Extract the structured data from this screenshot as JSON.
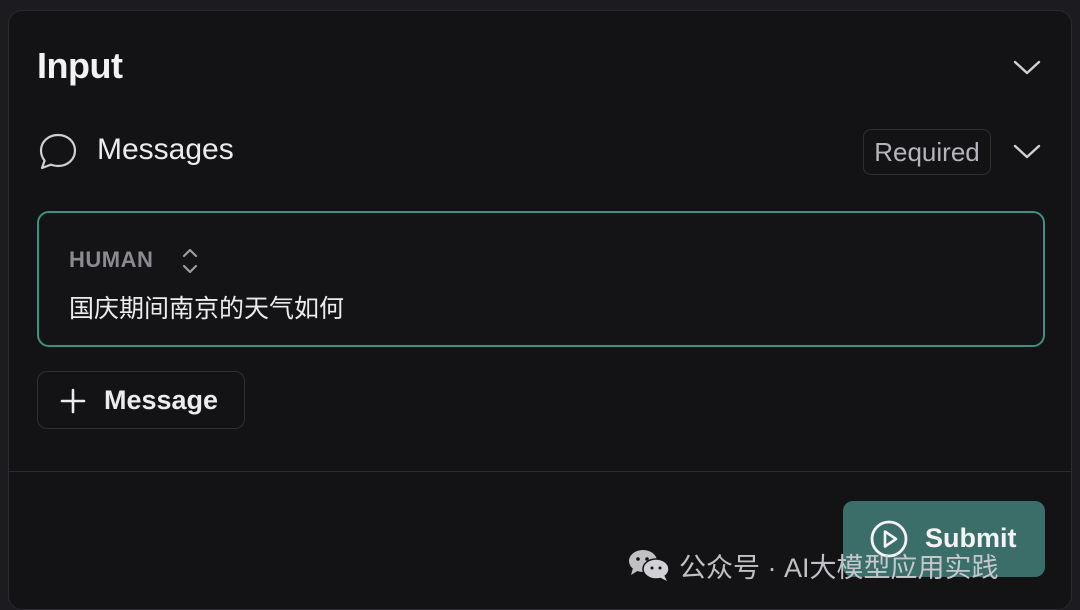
{
  "input": {
    "title": "Input"
  },
  "messages": {
    "label": "Messages",
    "required_label": "Required",
    "items": [
      {
        "role": "HUMAN",
        "content": "国庆期间南京的天气如何"
      }
    ],
    "add_label": "Message"
  },
  "actions": {
    "submit_label": "Submit"
  },
  "watermark": {
    "text": "公众号 · AI大模型应用实践"
  },
  "icons": {
    "collapse": "chevron-down-icon",
    "messages": "chat-bubble-icon",
    "role_toggle": "up-down-chevron-icon",
    "add": "plus-icon",
    "submit": "play-circle-icon",
    "watermark": "wechat-icon"
  },
  "colors": {
    "background": "#131316",
    "card_border": "#3f8f82",
    "submit_bg": "#3b6e68",
    "text_primary": "#ececef",
    "text_muted": "#8a8a92"
  }
}
